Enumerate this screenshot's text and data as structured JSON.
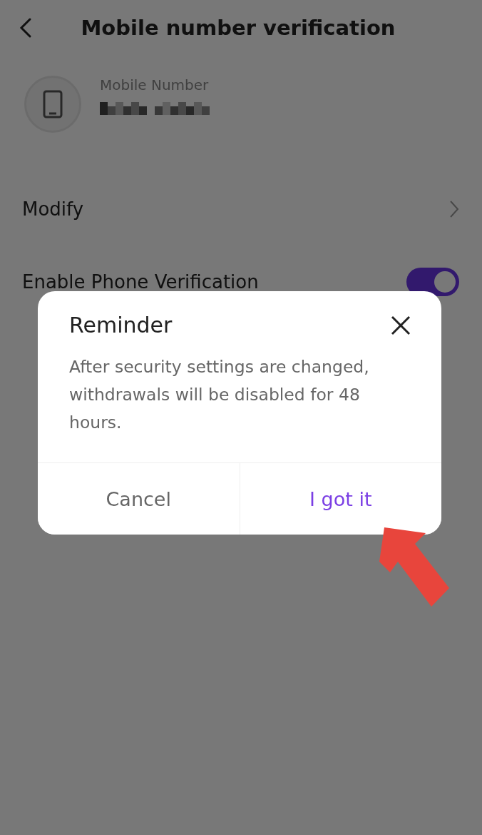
{
  "header": {
    "title": "Mobile number verification"
  },
  "account": {
    "label": "Mobile Number"
  },
  "settings": [
    {
      "kind": "link",
      "label": "Modify"
    },
    {
      "kind": "toggle",
      "label": "Enable Phone Verification",
      "on": true
    }
  ],
  "dialog": {
    "title": "Reminder",
    "message": "After security settings are changed, withdrawals will be disabled for 48 hours.",
    "buttons": [
      {
        "label": "Cancel",
        "primary": false
      },
      {
        "label": "I got it",
        "primary": true
      }
    ]
  }
}
